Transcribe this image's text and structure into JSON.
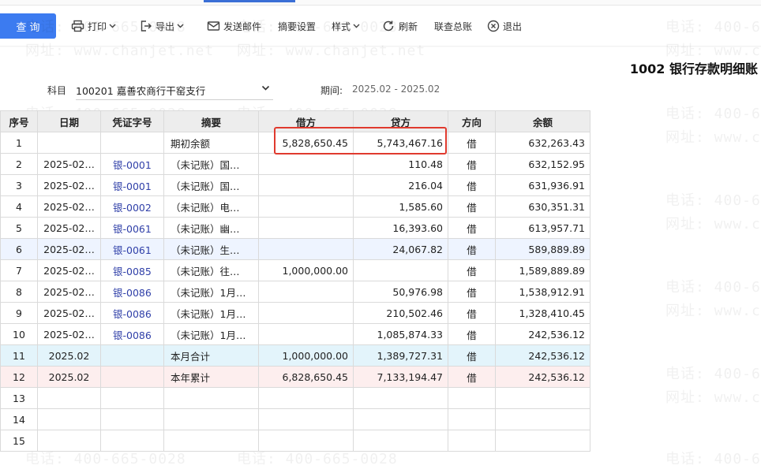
{
  "toolbar": {
    "query": "查 询",
    "print": "打印",
    "export": "导出",
    "send_mail": "发送邮件",
    "summary_settings": "摘要设置",
    "style": "样式",
    "refresh": "刷新",
    "linked_ledger": "联查总账",
    "exit": "退出"
  },
  "report": {
    "title": "1002 银行存款明细账",
    "subject_label": "科目",
    "subject_value": "100201 嘉善农商行干窑支行",
    "period_label": "期间:",
    "period_value": "2025.02 - 2025.02"
  },
  "table": {
    "headers": [
      "序号",
      "日期",
      "凭证字号",
      "摘要",
      "借方",
      "贷方",
      "方向",
      "余额"
    ],
    "rows": [
      {
        "no": "1",
        "date": "",
        "voucher": "",
        "summary": "期初余额",
        "debit": "5,828,650.45",
        "credit": "5,743,467.16",
        "dir": "借",
        "balance": "632,263.43"
      },
      {
        "no": "2",
        "date": "2025-02…",
        "voucher": "银-0001",
        "summary": "（未记账）国…",
        "debit": "",
        "credit": "110.48",
        "dir": "借",
        "balance": "632,152.95"
      },
      {
        "no": "3",
        "date": "2025-02…",
        "voucher": "银-0001",
        "summary": "（未记账）国…",
        "debit": "",
        "credit": "216.04",
        "dir": "借",
        "balance": "631,936.91"
      },
      {
        "no": "4",
        "date": "2025-02…",
        "voucher": "银-0002",
        "summary": "（未记账）电…",
        "debit": "",
        "credit": "1,585.60",
        "dir": "借",
        "balance": "630,351.31"
      },
      {
        "no": "5",
        "date": "2025-02…",
        "voucher": "银-0061",
        "summary": "（未记账）幽…",
        "debit": "",
        "credit": "16,393.60",
        "dir": "借",
        "balance": "613,957.71"
      },
      {
        "no": "6",
        "date": "2025-02…",
        "voucher": "银-0061",
        "summary": "（未记账）生…",
        "debit": "",
        "credit": "24,067.82",
        "dir": "借",
        "balance": "589,889.89"
      },
      {
        "no": "7",
        "date": "2025-02…",
        "voucher": "银-0085",
        "summary": "（未记账）往…",
        "debit": "1,000,000.00",
        "credit": "",
        "dir": "借",
        "balance": "1,589,889.89"
      },
      {
        "no": "8",
        "date": "2025-02…",
        "voucher": "银-0086",
        "summary": "（未记账）1月…",
        "debit": "",
        "credit": "50,976.98",
        "dir": "借",
        "balance": "1,538,912.91"
      },
      {
        "no": "9",
        "date": "2025-02…",
        "voucher": "银-0086",
        "summary": "（未记账）1月…",
        "debit": "",
        "credit": "210,502.46",
        "dir": "借",
        "balance": "1,328,410.45"
      },
      {
        "no": "10",
        "date": "2025-02…",
        "voucher": "银-0086",
        "summary": "（未记账）1月…",
        "debit": "",
        "credit": "1,085,874.33",
        "dir": "借",
        "balance": "242,536.12"
      },
      {
        "no": "11",
        "date": "2025.02",
        "voucher": "",
        "summary": "本月合计",
        "debit": "1,000,000.00",
        "credit": "1,389,727.31",
        "dir": "借",
        "balance": "242,536.12"
      },
      {
        "no": "12",
        "date": "2025.02",
        "voucher": "",
        "summary": "本年累计",
        "debit": "6,828,650.45",
        "credit": "7,133,194.47",
        "dir": "借",
        "balance": "242,536.12"
      },
      {
        "no": "13",
        "date": "",
        "voucher": "",
        "summary": "",
        "debit": "",
        "credit": "",
        "dir": "",
        "balance": ""
      },
      {
        "no": "14",
        "date": "",
        "voucher": "",
        "summary": "",
        "debit": "",
        "credit": "",
        "dir": "",
        "balance": ""
      },
      {
        "no": "15",
        "date": "",
        "voucher": "",
        "summary": "",
        "debit": "",
        "credit": "",
        "dir": "",
        "balance": ""
      }
    ]
  },
  "watermark": {
    "phone": "电话: 400-665-0028",
    "site": "网址: www.chanjet.net"
  },
  "colors": {
    "primary": "#3c7bf0",
    "highlight_border": "#e03a2e",
    "voucher_link": "#2f3fa8",
    "month_total_bg": "#e3f4fb",
    "year_total_bg": "#fdeeee"
  }
}
